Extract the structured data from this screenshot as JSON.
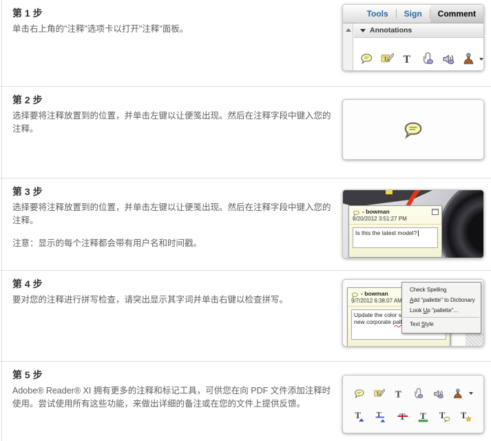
{
  "steps": [
    {
      "heading": "第 1 步",
      "body": "单击右上角的\"注释\"选项卡以打开\"注释\"面板。"
    },
    {
      "heading": "第 2 步",
      "body": "选择要将注释放置到的位置，并单击左键以让便笺出现。然后在注释字段中键入您的注释。"
    },
    {
      "heading": "第 3 步",
      "body": "选择要将注释放置到的位置，并单击左键以让便笺出现。然后在注释字段中键入您的注释。",
      "note": "注意：显示的每个注释都会带有用户名和时间戳。"
    },
    {
      "heading": "第 4 步",
      "body": "要对您的注释进行拼写检查，请突出显示其字词并单击右键以检查拼写。"
    },
    {
      "heading": "第 5 步",
      "body": "Adobe® Reader® XI 拥有更多的注释和标记工具，可供您在向 PDF 文件添加注释时使用。尝试使用所有这些功能，来做出详细的备注或在您的文件上提供反馈。"
    }
  ],
  "figure1": {
    "tabs": [
      {
        "label": "Tools"
      },
      {
        "label": "Sign"
      },
      {
        "label": "Comment"
      }
    ],
    "active_tab": "Comment",
    "panel_header": "Annotations",
    "toolbar_icons": [
      "sticky-note-icon",
      "highlight-text-icon",
      "add-text-icon",
      "attach-file-icon",
      "record-audio-icon",
      "stamp-icon"
    ]
  },
  "figure2": {
    "icon": "sticky-note-icon"
  },
  "figure3": {
    "author_label": "- bowman",
    "timestamp": "8/20/2012 3:51:27 PM",
    "note_text": "Is this the latest model?"
  },
  "figure4": {
    "author_label": "- bowman",
    "timestamp": "9/7/2012 6:38:07 AM",
    "note_line1": "Update the color sch",
    "note_line2_pre": "new corporate ",
    "note_line2_word": "pallet...",
    "menu": {
      "items": [
        {
          "pre": "Check Spellin",
          "key": "g",
          "post": ""
        },
        {
          "pre": "",
          "key": "A",
          "post": "dd \"pallette\" to Dictionary"
        },
        {
          "pre": "Look ",
          "key": "U",
          "post": "p \"pallette\"..."
        },
        {
          "pre": "Text ",
          "key": "S",
          "post": "tyle"
        }
      ]
    }
  },
  "figure5": {
    "row1_icons": [
      "sticky-note-icon",
      "highlight-text-icon",
      "add-text-icon",
      "attach-file-icon",
      "record-audio-icon",
      "stamp-icon"
    ],
    "row2_icons": [
      "insert-text-icon",
      "replace-text-icon",
      "strikethrough-icon",
      "underline-icon",
      "add-note-to-text-icon",
      "text-star-icon"
    ]
  },
  "colors": {
    "tab_link_blue": "#2a66a3",
    "heading_text": "#333333",
    "body_text": "#5e5e5e",
    "note_yellow": "#fcfbe3",
    "bubble_yellow": "#fffcae",
    "camera_red": "#e63418",
    "strike_red": "#cc2222",
    "underline_green": "#3fae49",
    "caret_blue": "#3b5bd6",
    "stamp_brown": "#b2673a",
    "audio_purple": "#a89ae0",
    "star_gold": "#f5c63d",
    "squiggle_red": "#e03020"
  }
}
